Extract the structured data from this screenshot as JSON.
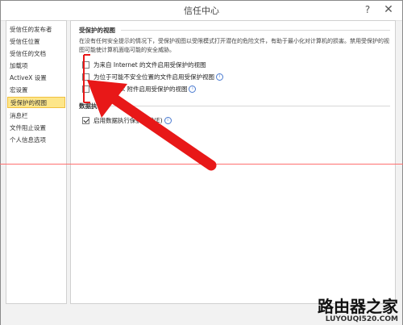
{
  "window": {
    "title": "信任中心",
    "help_icon": "?",
    "close_icon": "✕"
  },
  "sidebar": {
    "items": [
      {
        "label": "受信任的发布者"
      },
      {
        "label": "受信任位置"
      },
      {
        "label": "受信任的文档"
      },
      {
        "label": "加载项"
      },
      {
        "label": "ActiveX 设置"
      },
      {
        "label": "宏设置"
      },
      {
        "label": "受保护的视图",
        "active": true
      },
      {
        "label": "消息栏"
      },
      {
        "label": "文件阻止设置"
      },
      {
        "label": "个人信息选项"
      }
    ]
  },
  "protected_view": {
    "title": "受保护的视图",
    "description": "在没有任何安全提示的情况下，受保护视图以受限模式打开潜在的危险文件，有助于最小化对计算机的损害。禁用受保护的视图可能使计算机面临可能的安全威胁。",
    "options": [
      {
        "label": "为来自 Internet 的文件启用受保护的视图",
        "checked": false,
        "info": false
      },
      {
        "label": "为位于可能不安全位置的文件启用受保护视图",
        "checked": false,
        "info": true
      },
      {
        "label": "为 Outlook 附件启用受保护的视图",
        "checked": false,
        "info": true
      }
    ]
  },
  "data_execution": {
    "title": "数据执行",
    "option": {
      "label": "启用数据执行保护模式(E)",
      "checked": true,
      "info": true
    }
  },
  "watermark": {
    "name": "路由器之家",
    "url": "LUYOUQI520.COM"
  },
  "colors": {
    "arrow": "#e81818",
    "active_item_bg": "#fde68a",
    "guide_line": "#ff7070"
  }
}
